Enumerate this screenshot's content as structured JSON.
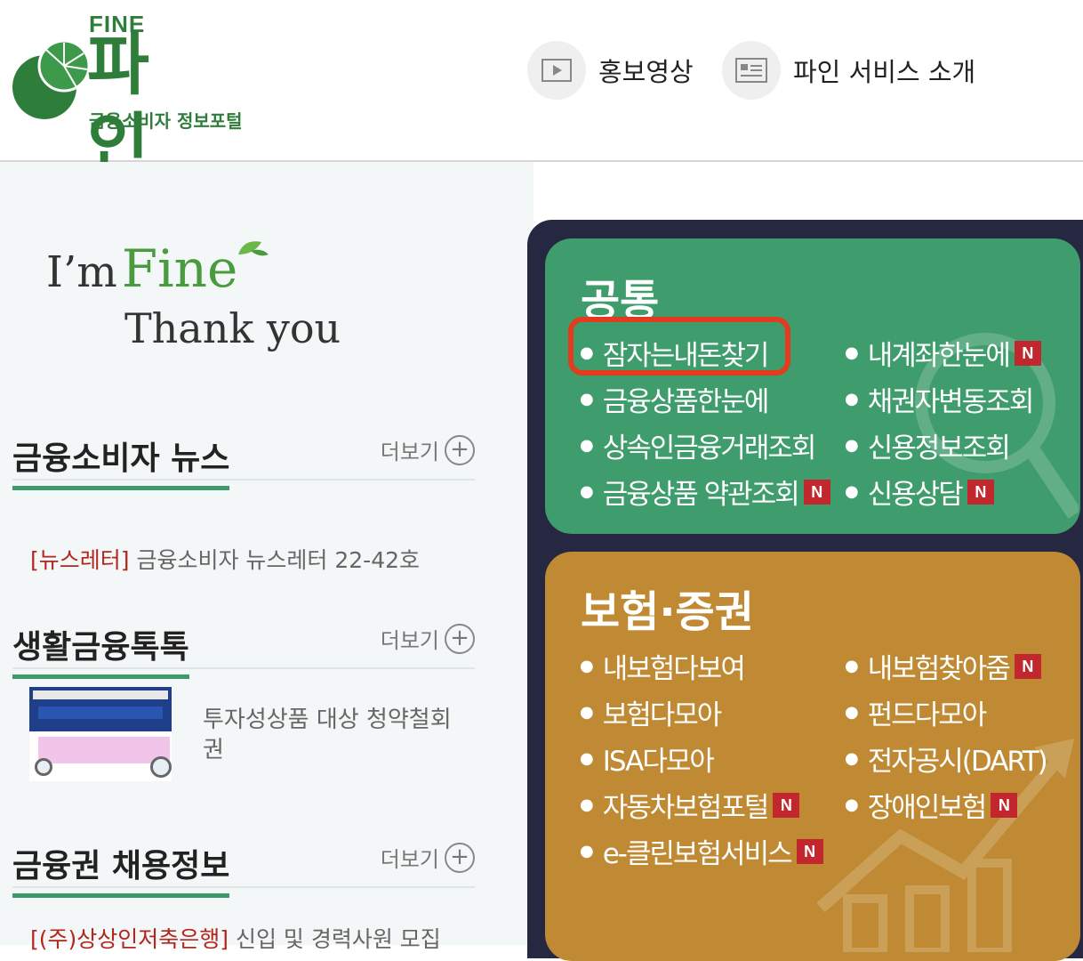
{
  "header": {
    "logo": {
      "eng": "FINE",
      "main": "파 인",
      "subtitle": "금융소비자 정보포털"
    },
    "promo_video": "홍보영상",
    "service_intro": "파인 서비스 소개"
  },
  "tagline": {
    "im": "I’m",
    "fine": "Fine",
    "thank_you": "Thank you"
  },
  "sections": {
    "news": {
      "title": "금융소비자 뉴스",
      "more": "더보기",
      "item_tag": "[뉴스레터]",
      "item_text": "금융소비자 뉴스레터 22-42호"
    },
    "life": {
      "title": "생활금융톡톡",
      "more": "더보기",
      "item_text": "투자성상품 대상 청약철회권"
    },
    "jobs": {
      "title": "금융권 채용정보",
      "more": "더보기",
      "item_tag": "[(주)상상인저축은행]",
      "item_text": "신입 및 경력사원 모집"
    }
  },
  "common": {
    "title": "공통",
    "items": [
      {
        "label": "잠자는내돈찾기",
        "new": false
      },
      {
        "label": "금융상품한눈에",
        "new": false
      },
      {
        "label": "상속인금융거래조회",
        "new": false
      },
      {
        "label": "금융상품 약관조회",
        "new": true
      },
      {
        "label": "내계좌한눈에",
        "new": true
      },
      {
        "label": "채권자변동조회",
        "new": false
      },
      {
        "label": "신용정보조회",
        "new": false
      },
      {
        "label": "신용상담",
        "new": true
      }
    ]
  },
  "insurance": {
    "title": "보험·증권",
    "items": [
      {
        "label": "내보험다보여",
        "new": false
      },
      {
        "label": "보험다모아",
        "new": false
      },
      {
        "label": "ISA다모아",
        "new": false
      },
      {
        "label": "자동차보험포털",
        "new": true
      },
      {
        "label": "e-클린보험서비스",
        "new": true
      },
      {
        "label": "내보험찾아줌",
        "new": true
      },
      {
        "label": "펀드다모아",
        "new": false
      },
      {
        "label": "전자공시(DART)",
        "new": false
      },
      {
        "label": "장애인보험",
        "new": true
      }
    ]
  },
  "badge_new": "N",
  "colors": {
    "brand_green": "#2f7d3b",
    "card_green": "#3f9c6c",
    "card_gold": "#bf8a33",
    "panel": "#262841",
    "highlight": "#e23b1f"
  }
}
